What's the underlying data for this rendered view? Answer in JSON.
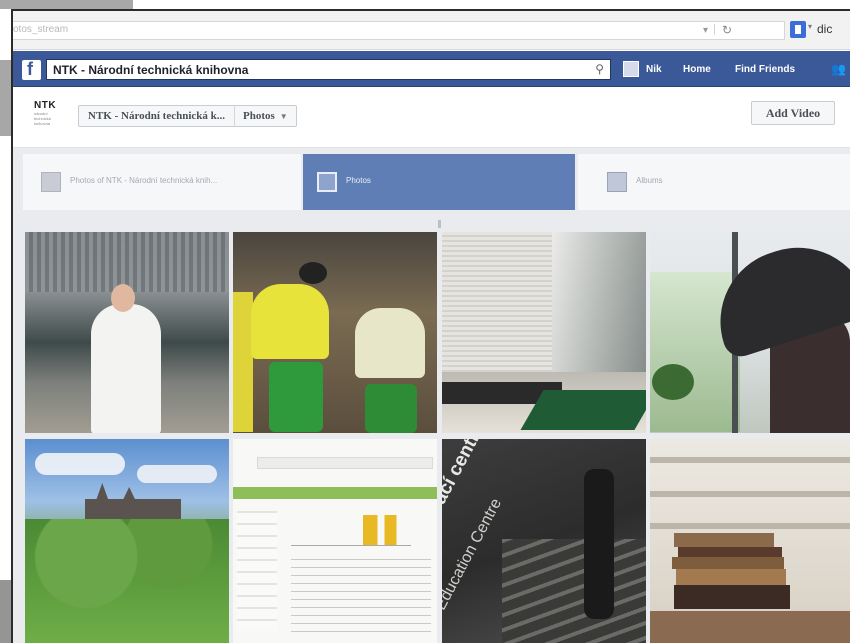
{
  "browser": {
    "url": "otos_stream",
    "search_engine_text": "dic"
  },
  "facebook_bar": {
    "search_value": "NTK - Národní technická knihovna",
    "user_name": "Nik",
    "nav_home": "Home",
    "nav_find_friends": "Find Friends"
  },
  "page_header": {
    "logo_text": "NTK",
    "logo_subtext": "národní technická knihovna",
    "breadcrumb_page": "NTK - Národní technická k...",
    "breadcrumb_section": "Photos",
    "add_video_label": "Add Video"
  },
  "tabs": [
    {
      "label": "Photos of NTK - Národní technická knih..."
    },
    {
      "label": "Photos"
    },
    {
      "label": "Albums"
    }
  ],
  "photos": [
    {
      "alt": "man in white shirt"
    },
    {
      "alt": "drummers in yellow"
    },
    {
      "alt": "hall with benches"
    },
    {
      "alt": "person with umbrella"
    },
    {
      "alt": "castle view"
    },
    {
      "alt": "website screenshot"
    },
    {
      "alt": "stairs sign"
    },
    {
      "alt": "stack of books"
    }
  ],
  "photo_text": {
    "sign_main": "zdělávací centrum",
    "sign_sub": "Education Centre"
  },
  "colors": {
    "facebook_blue": "#3b5998",
    "active_tab": "#5f7eb6"
  }
}
